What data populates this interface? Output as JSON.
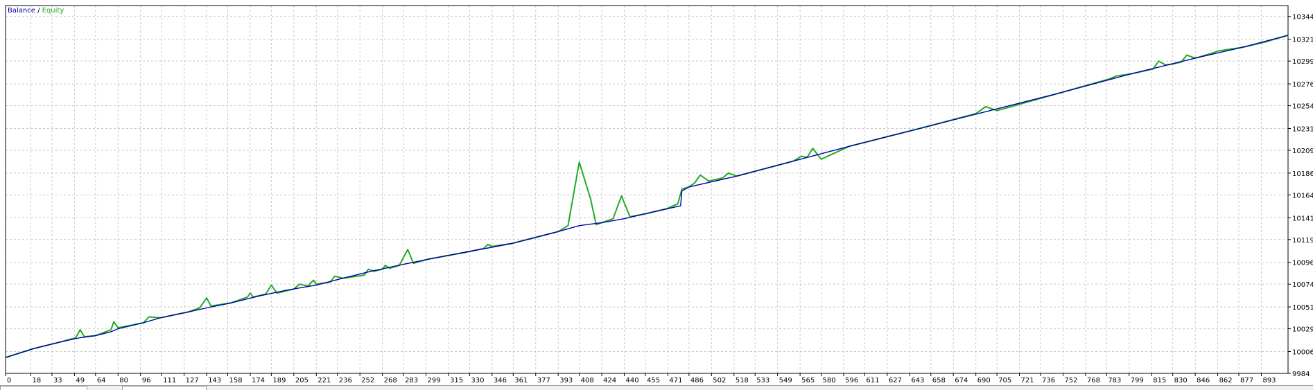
{
  "chart_data": {
    "type": "line",
    "legend": {
      "position": "top-left",
      "separator": " / ",
      "entries": [
        {
          "name": "Balance",
          "color": "#0000aa"
        },
        {
          "name": "Equity",
          "color": "#22aa22"
        }
      ]
    },
    "title": "",
    "xlabel": "",
    "ylabel": "",
    "xlim": [
      0,
      912
    ],
    "ylim": [
      9984,
      10355
    ],
    "grid": true,
    "x_ticks": [
      "0",
      "18",
      "33",
      "49",
      "64",
      "80",
      "96",
      "111",
      "127",
      "143",
      "158",
      "174",
      "189",
      "205",
      "221",
      "236",
      "252",
      "268",
      "283",
      "299",
      "315",
      "330",
      "346",
      "361",
      "377",
      "393",
      "408",
      "424",
      "440",
      "455",
      "471",
      "486",
      "502",
      "518",
      "533",
      "549",
      "565",
      "580",
      "596",
      "611",
      "627",
      "643",
      "658",
      "674",
      "690",
      "705",
      "721",
      "736",
      "752",
      "768",
      "783",
      "799",
      "815",
      "830",
      "846",
      "862",
      "877",
      "893"
    ],
    "y_ticks": [
      "9984",
      "10006",
      "10029",
      "10051",
      "10074",
      "10096",
      "10119",
      "10141",
      "10164",
      "10186",
      "10209",
      "10231",
      "10254",
      "10276",
      "10299",
      "10321",
      "10344"
    ],
    "series": [
      {
        "name": "Balance",
        "color": "#0000aa",
        "points": [
          [
            0,
            10000
          ],
          [
            20,
            10009
          ],
          [
            40,
            10016
          ],
          [
            53,
            10020
          ],
          [
            64,
            10022
          ],
          [
            75,
            10026
          ],
          [
            80,
            10029
          ],
          [
            98,
            10035
          ],
          [
            110,
            10040
          ],
          [
            130,
            10046
          ],
          [
            143,
            10050
          ],
          [
            160,
            10055
          ],
          [
            180,
            10062
          ],
          [
            200,
            10068
          ],
          [
            221,
            10073
          ],
          [
            240,
            10080
          ],
          [
            260,
            10087
          ],
          [
            283,
            10094
          ],
          [
            300,
            10099
          ],
          [
            330,
            10107
          ],
          [
            360,
            10115
          ],
          [
            393,
            10127
          ],
          [
            408,
            10133
          ],
          [
            424,
            10136
          ],
          [
            440,
            10140
          ],
          [
            455,
            10145
          ],
          [
            480,
            10153
          ],
          [
            481,
            10168
          ],
          [
            486,
            10172
          ],
          [
            520,
            10183
          ],
          [
            560,
            10198
          ],
          [
            600,
            10213
          ],
          [
            650,
            10231
          ],
          [
            700,
            10249
          ],
          [
            750,
            10267
          ],
          [
            800,
            10286
          ],
          [
            846,
            10302
          ],
          [
            880,
            10313
          ],
          [
            912,
            10325
          ]
        ]
      },
      {
        "name": "Equity",
        "color": "#22aa22",
        "points": [
          [
            0,
            10000
          ],
          [
            20,
            10009
          ],
          [
            40,
            10016
          ],
          [
            50,
            10020
          ],
          [
            53,
            10028
          ],
          [
            56,
            10021
          ],
          [
            64,
            10022
          ],
          [
            75,
            10028
          ],
          [
            77,
            10036
          ],
          [
            80,
            10030
          ],
          [
            98,
            10035
          ],
          [
            102,
            10041
          ],
          [
            110,
            10040
          ],
          [
            130,
            10046
          ],
          [
            138,
            10050
          ],
          [
            143,
            10060
          ],
          [
            146,
            10052
          ],
          [
            160,
            10055
          ],
          [
            172,
            10061
          ],
          [
            174,
            10065
          ],
          [
            176,
            10061
          ],
          [
            185,
            10064
          ],
          [
            189,
            10073
          ],
          [
            193,
            10065
          ],
          [
            205,
            10069
          ],
          [
            209,
            10074
          ],
          [
            215,
            10072
          ],
          [
            219,
            10078
          ],
          [
            221,
            10074
          ],
          [
            231,
            10076
          ],
          [
            234,
            10082
          ],
          [
            240,
            10080
          ],
          [
            255,
            10083
          ],
          [
            258,
            10089
          ],
          [
            262,
            10087
          ],
          [
            268,
            10089
          ],
          [
            270,
            10093
          ],
          [
            273,
            10090
          ],
          [
            280,
            10093
          ],
          [
            286,
            10109
          ],
          [
            290,
            10095
          ],
          [
            300,
            10099
          ],
          [
            330,
            10107
          ],
          [
            340,
            10110
          ],
          [
            343,
            10114
          ],
          [
            346,
            10112
          ],
          [
            360,
            10115
          ],
          [
            393,
            10127
          ],
          [
            400,
            10133
          ],
          [
            408,
            10197
          ],
          [
            416,
            10160
          ],
          [
            420,
            10134
          ],
          [
            424,
            10136
          ],
          [
            432,
            10140
          ],
          [
            438,
            10163
          ],
          [
            444,
            10142
          ],
          [
            455,
            10145
          ],
          [
            470,
            10150
          ],
          [
            478,
            10155
          ],
          [
            481,
            10170
          ],
          [
            486,
            10172
          ],
          [
            490,
            10176
          ],
          [
            494,
            10184
          ],
          [
            500,
            10178
          ],
          [
            510,
            10181
          ],
          [
            514,
            10186
          ],
          [
            520,
            10183
          ],
          [
            560,
            10198
          ],
          [
            566,
            10203
          ],
          [
            570,
            10202
          ],
          [
            574,
            10211
          ],
          [
            580,
            10200
          ],
          [
            600,
            10213
          ],
          [
            650,
            10231
          ],
          [
            690,
            10246
          ],
          [
            697,
            10253
          ],
          [
            705,
            10249
          ],
          [
            750,
            10267
          ],
          [
            785,
            10281
          ],
          [
            790,
            10284
          ],
          [
            800,
            10286
          ],
          [
            816,
            10291
          ],
          [
            820,
            10299
          ],
          [
            825,
            10295
          ],
          [
            830,
            10296
          ],
          [
            836,
            10298
          ],
          [
            840,
            10305
          ],
          [
            846,
            10302
          ],
          [
            858,
            10307
          ],
          [
            862,
            10309
          ],
          [
            880,
            10313
          ],
          [
            895,
            10318
          ],
          [
            900,
            10320
          ],
          [
            912,
            10325
          ]
        ]
      }
    ]
  }
}
